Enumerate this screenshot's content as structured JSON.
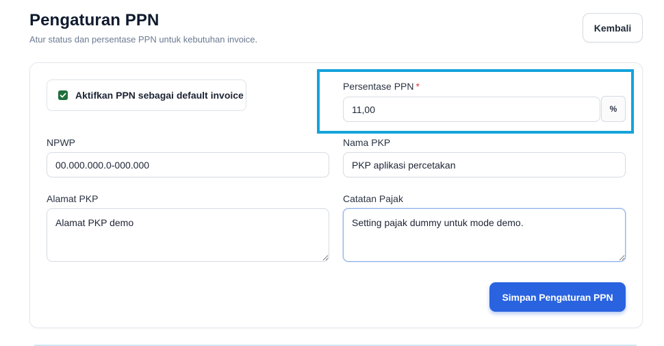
{
  "header": {
    "title": "Pengaturan PPN",
    "subtitle": "Atur status dan persentase PPN untuk kebutuhan invoice.",
    "back_label": "Kembali"
  },
  "form": {
    "enable_ppn": {
      "label": "Aktifkan PPN sebagai default invoice",
      "checked": true
    },
    "persentase": {
      "label": "Persentase PPN",
      "required_mark": "*",
      "value": "11,00",
      "suffix": "%"
    },
    "npwp": {
      "label": "NPWP",
      "value": "00.000.000.0-000.000"
    },
    "nama_pkp": {
      "label": "Nama PKP",
      "value": "PKP aplikasi percetakan"
    },
    "alamat_pkp": {
      "label": "Alamat PKP",
      "value": "Alamat PKP demo"
    },
    "catatan_pajak": {
      "label": "Catatan Pajak",
      "value": "Setting pajak dummy untuk mode demo."
    },
    "save_label": "Simpan Pengaturan PPN"
  },
  "colors": {
    "primary": "#2a63e0",
    "checkbox": "#1f6f3a",
    "highlight": "#14a3dc",
    "required": "#e0343f"
  }
}
